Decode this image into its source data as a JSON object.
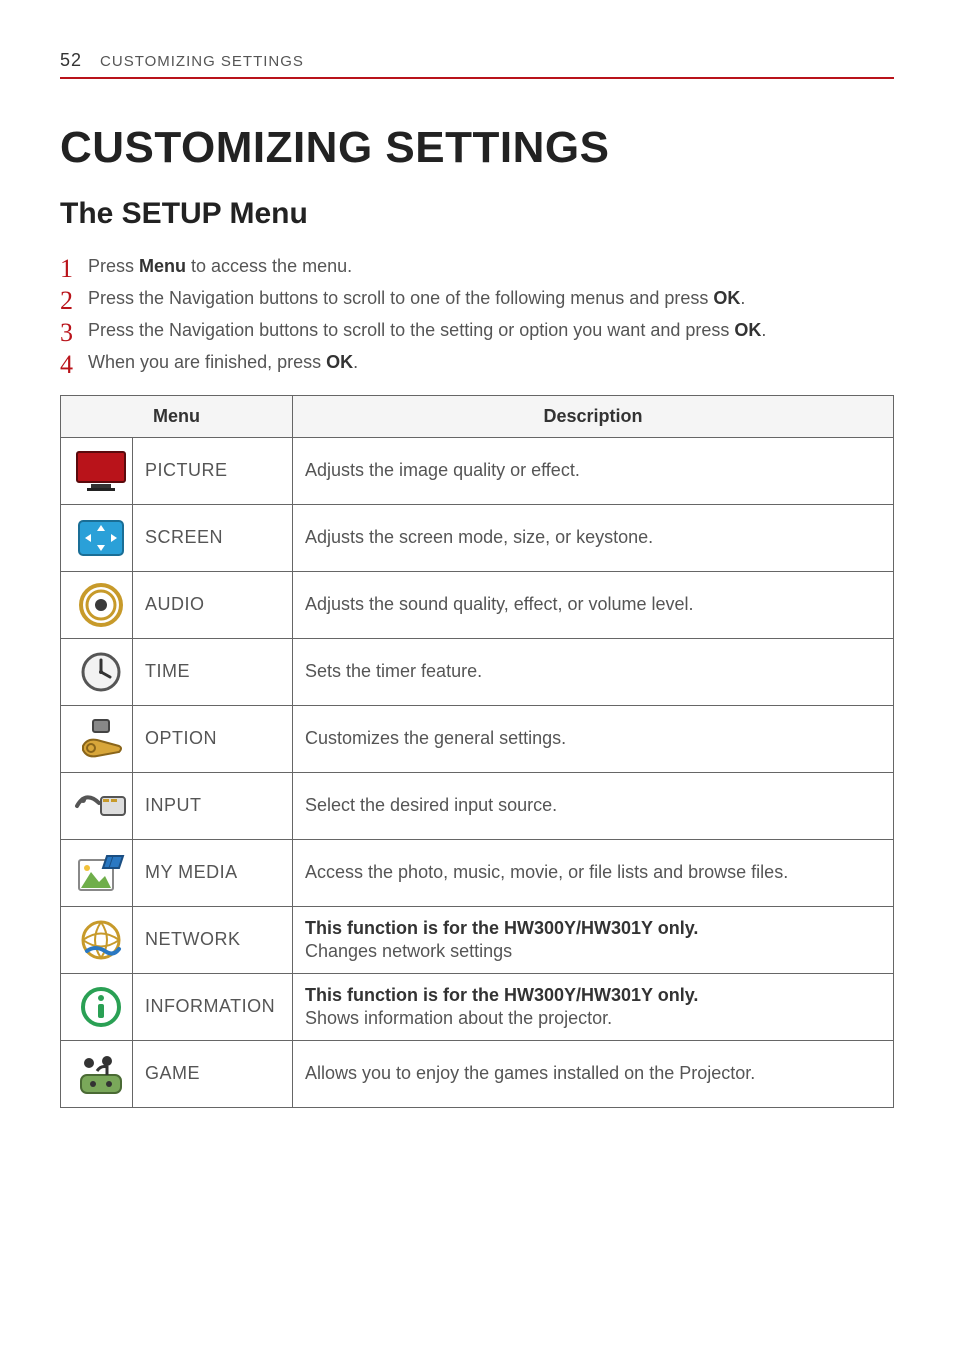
{
  "header": {
    "page_number": "52",
    "running_head": "CUSTOMIZING SETTINGS"
  },
  "title": "CUSTOMIZING SETTINGS",
  "subtitle": "The SETUP Menu",
  "steps": [
    {
      "num": "1",
      "pre": "Press ",
      "bold": "Menu",
      "post": " to access the menu."
    },
    {
      "num": "2",
      "pre": "Press the Navigation buttons to scroll to one of the following menus and press ",
      "bold": "OK",
      "post": "."
    },
    {
      "num": "3",
      "pre": "Press the Navigation buttons to scroll to the setting or option you want and press ",
      "bold": "OK",
      "post": "."
    },
    {
      "num": "4",
      "pre": "When you are finished, press ",
      "bold": "OK",
      "post": "."
    }
  ],
  "table": {
    "headers": {
      "menu": "Menu",
      "description": "Description"
    },
    "rows": [
      {
        "icon": "picture-icon",
        "menu": "PICTURE",
        "bold": "",
        "desc": "Adjusts the image quality or effect."
      },
      {
        "icon": "screen-icon",
        "menu": "SCREEN",
        "bold": "",
        "desc": "Adjusts the screen mode, size, or keystone."
      },
      {
        "icon": "audio-icon",
        "menu": "AUDIO",
        "bold": "",
        "desc": "Adjusts the sound quality, effect, or volume level."
      },
      {
        "icon": "time-icon",
        "menu": "TIME",
        "bold": "",
        "desc": "Sets the timer feature."
      },
      {
        "icon": "option-icon",
        "menu": "OPTION",
        "bold": "",
        "desc": "Customizes the general settings."
      },
      {
        "icon": "input-icon",
        "menu": "INPUT",
        "bold": "",
        "desc": "Select the desired input source."
      },
      {
        "icon": "mymedia-icon",
        "menu": "MY MEDIA",
        "bold": "",
        "desc": "Access the photo, music, movie, or file lists and browse files."
      },
      {
        "icon": "network-icon",
        "menu": "NETWORK",
        "bold": "This function is for the HW300Y/HW301Y only.",
        "desc": "Changes network settings"
      },
      {
        "icon": "information-icon",
        "menu": "INFORMATION",
        "bold": "This function is for the HW300Y/HW301Y only.",
        "desc": "Shows information about the projector."
      },
      {
        "icon": "game-icon",
        "menu": "GAME",
        "bold": "",
        "desc": "Allows you to enjoy the games installed on the Projector."
      }
    ]
  }
}
